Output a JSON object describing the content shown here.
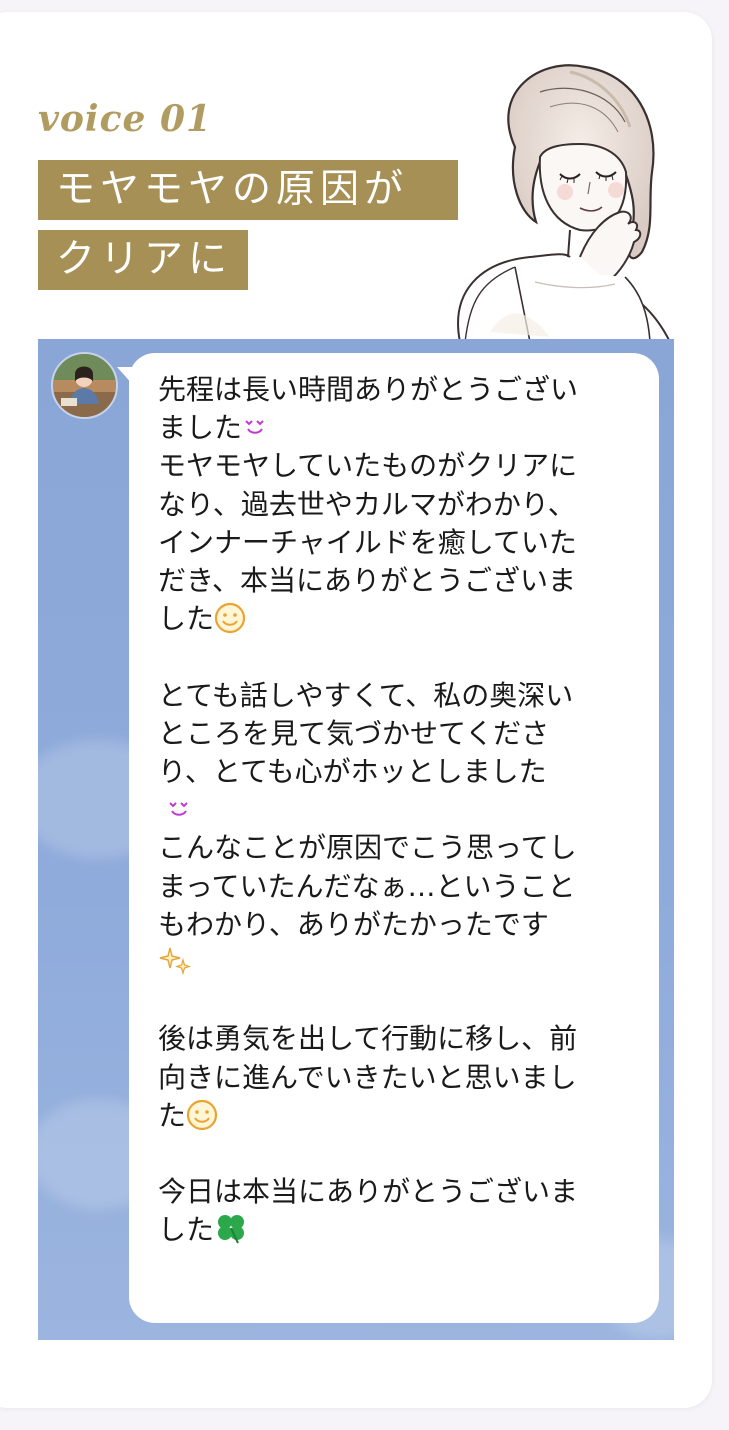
{
  "header": {
    "voice_label": "voice 01",
    "title_line1": "モヤモヤの原因が",
    "title_line2": "クリアに"
  },
  "message": {
    "line01": "先程は長い時間ありがとうござい",
    "line02": "ました",
    "line03": "モヤモヤしていたものがクリアに",
    "line04": "なり、過去世やカルマがわかり、",
    "line05": "インナーチャイルドを癒していた",
    "line06": "だき、本当にありがとうございま",
    "line07": "した",
    "line08": "とても話しやすくて、私の奥深い",
    "line09": "ところを見て気づかせてくださ",
    "line10": "り、とても心がホッとしました",
    "line11": "こんなことが原因でこう思ってし",
    "line12": "まっていたんだなぁ…ということ",
    "line13": "もわかり、ありがたかったです",
    "line14": "後は勇気を出して行動に移し、前",
    "line15": "向きに進んでいきたいと思いまし",
    "line16": "た",
    "line17": "今日は本当にありがとうございま",
    "line18": "した"
  },
  "icons": {
    "hearts": "smiling-hearts-icon",
    "smile": "smiley-face-icon",
    "sparkle": "sparkles-icon",
    "clover": "four-leaf-clover-icon"
  },
  "colors": {
    "accent_gold": "#a69056",
    "voice_label": "#b09b60",
    "chat_background": "#8aa7d8",
    "bubble": "#ffffff",
    "text": "#1a1a1a"
  }
}
